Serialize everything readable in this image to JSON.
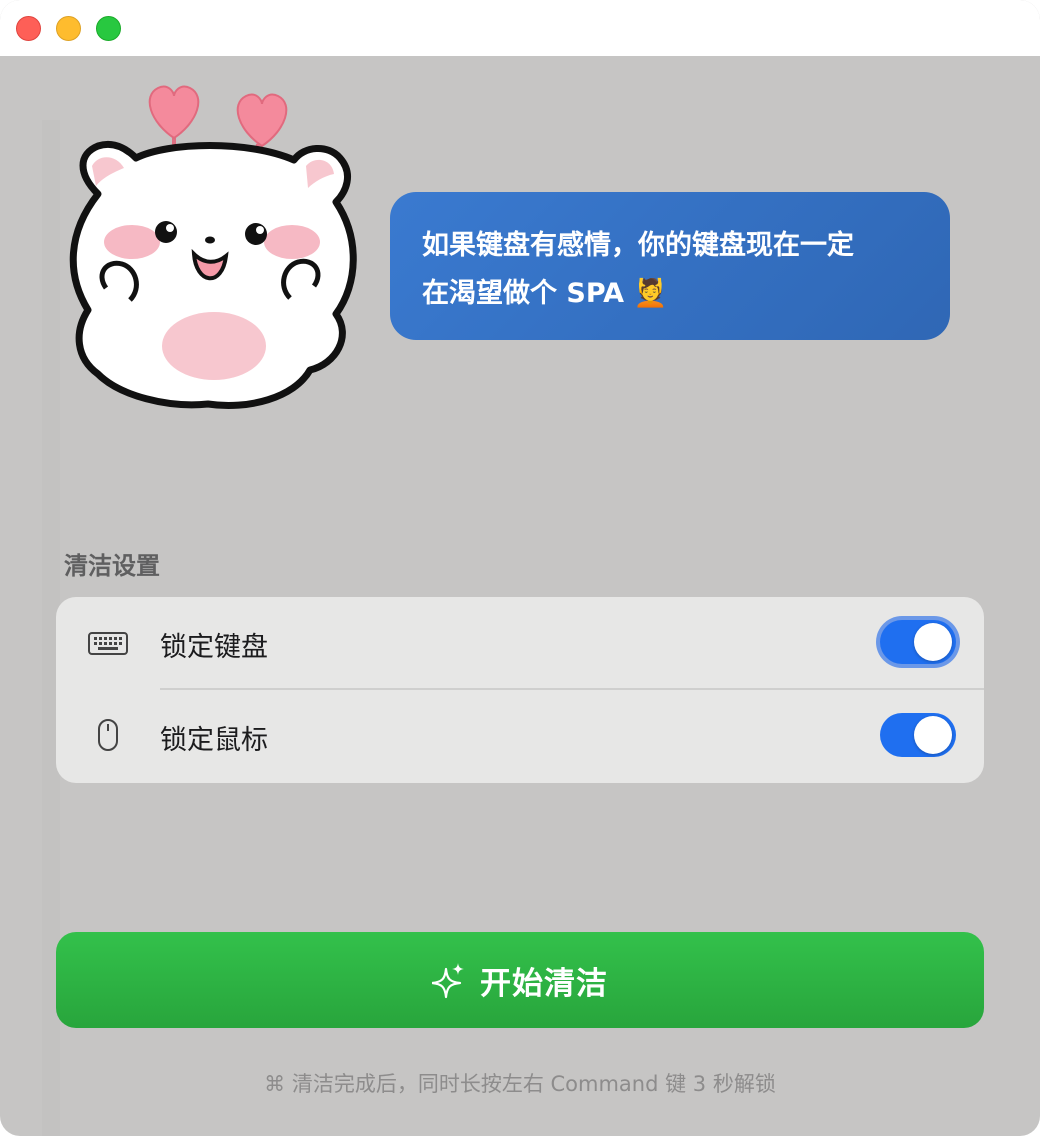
{
  "window": {
    "controls": [
      "close",
      "minimize",
      "zoom"
    ]
  },
  "bubble": {
    "line1": "如果键盘有感情，你的键盘现在一定",
    "line2": "在渴望做个 SPA 💆"
  },
  "settings": {
    "title": "清洁设置",
    "rows": [
      {
        "icon": "keyboard-icon",
        "label": "锁定键盘",
        "enabled": true
      },
      {
        "icon": "mouse-icon",
        "label": "锁定鼠标",
        "enabled": true
      }
    ]
  },
  "start_button": {
    "icon": "sparkle-icon",
    "label": "开始清洁"
  },
  "footer": {
    "text": "⌘ 清洁完成后，同时长按左右 Command 键 3 秒解锁"
  },
  "colors": {
    "window_bg": "#c6c5c4",
    "bubble": "#3474c6",
    "toggle_on": "#1f6ff0",
    "start_button": "#2fb646"
  }
}
